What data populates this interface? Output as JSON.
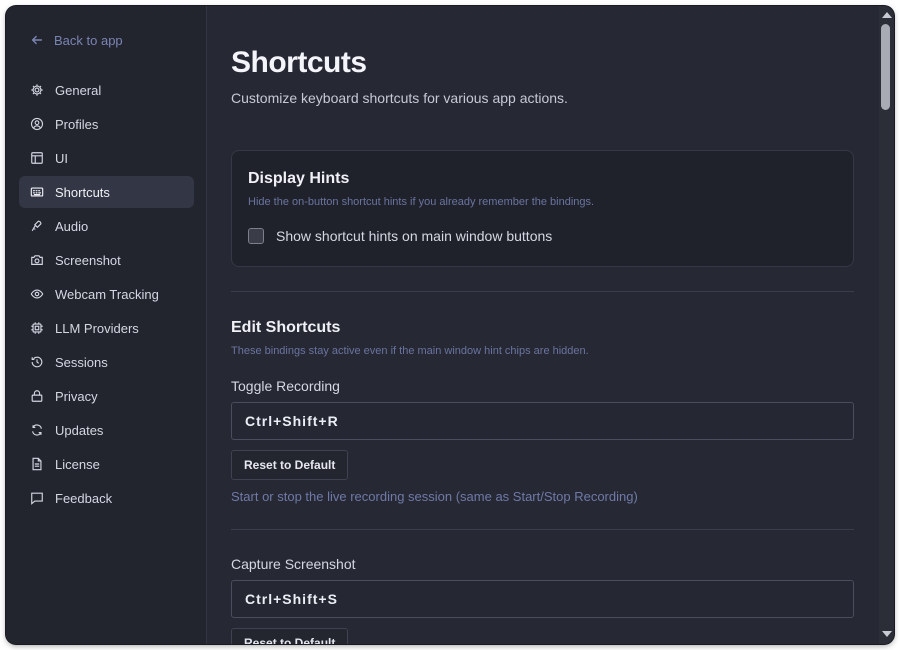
{
  "sidebar": {
    "back_label": "Back to app",
    "items": [
      {
        "label": "General",
        "icon": "gear-icon"
      },
      {
        "label": "Profiles",
        "icon": "user-circle-icon"
      },
      {
        "label": "UI",
        "icon": "layout-icon"
      },
      {
        "label": "Shortcuts",
        "icon": "keyboard-icon",
        "active": true
      },
      {
        "label": "Audio",
        "icon": "microphone-icon"
      },
      {
        "label": "Screenshot",
        "icon": "camera-icon"
      },
      {
        "label": "Webcam Tracking",
        "icon": "eye-icon"
      },
      {
        "label": "LLM Providers",
        "icon": "chip-icon"
      },
      {
        "label": "Sessions",
        "icon": "history-icon"
      },
      {
        "label": "Privacy",
        "icon": "lock-icon"
      },
      {
        "label": "Updates",
        "icon": "refresh-icon"
      },
      {
        "label": "License",
        "icon": "document-icon"
      },
      {
        "label": "Feedback",
        "icon": "message-icon"
      }
    ]
  },
  "page": {
    "title": "Shortcuts",
    "subtitle": "Customize keyboard shortcuts for various app actions."
  },
  "display_hints": {
    "title": "Display Hints",
    "description": "Hide the on-button shortcut hints if you already remember the bindings.",
    "checkbox_label": "Show shortcut hints on main window buttons",
    "checked": false
  },
  "edit_shortcuts": {
    "title": "Edit Shortcuts",
    "description": "These bindings stay active even if the main window hint chips are hidden.",
    "shortcuts": [
      {
        "label": "Toggle Recording",
        "binding": "Ctrl+Shift+R",
        "reset_label": "Reset to Default",
        "hint": "Start or stop the live recording session (same as Start/Stop Recording)"
      },
      {
        "label": "Capture Screenshot",
        "binding": "Ctrl+Shift+S",
        "reset_label": "Reset to Default"
      }
    ]
  },
  "colors": {
    "background": "#262833",
    "sidebar": "#22242e",
    "accent_text": "#6f7aa8"
  }
}
